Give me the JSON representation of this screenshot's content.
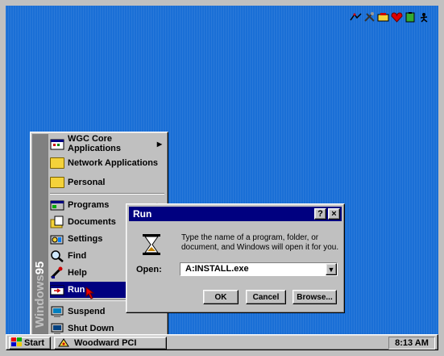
{
  "start_menu": {
    "brand": {
      "prefix": "Windows",
      "version": "95"
    },
    "items": [
      {
        "label": "WGC Core Applications",
        "icon": "program-group-icon",
        "submenu": true
      },
      {
        "label": "Network Applications",
        "icon": "folder-icon",
        "submenu": false
      },
      {
        "label": "Personal",
        "icon": "folder-icon",
        "submenu": false
      },
      {
        "label": "Programs",
        "icon": "programs-icon",
        "submenu": true
      },
      {
        "label": "Documents",
        "icon": "documents-icon",
        "submenu": true
      },
      {
        "label": "Settings",
        "icon": "settings-icon",
        "submenu": true
      },
      {
        "label": "Find",
        "icon": "find-icon",
        "submenu": true
      },
      {
        "label": "Help",
        "icon": "help-icon",
        "submenu": false
      },
      {
        "label": "Run",
        "icon": "run-icon",
        "submenu": false,
        "selected": true
      },
      {
        "label": "Suspend",
        "icon": "suspend-icon",
        "submenu": false
      },
      {
        "label": "Shut Down",
        "icon": "shutdown-icon",
        "submenu": false
      }
    ]
  },
  "run_dialog": {
    "title": "Run",
    "help_label": "?",
    "close_label": "×",
    "description": "Type the name of a program, folder, or document, and Windows will open it for you.",
    "open_label": "Open:",
    "open_value": "A:INSTALL.exe",
    "buttons": {
      "ok": "OK",
      "cancel": "Cancel",
      "browse": "Browse..."
    }
  },
  "taskbar": {
    "start_label": "Start",
    "task_label": "Woodward PCI",
    "clock": "8:13 AM"
  },
  "tray_icons": [
    "network-icon",
    "tools-icon",
    "phone-icon",
    "heart-icon",
    "battery-icon",
    "exit-icon"
  ],
  "colors": {
    "desktop": "#1a6fd6",
    "titlebar": "#000080",
    "chrome": "#c0c0c0",
    "selection": "#000080"
  }
}
